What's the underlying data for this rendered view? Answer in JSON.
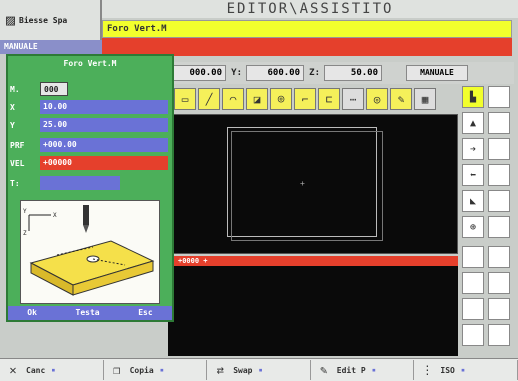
{
  "header": {
    "company": "Biesse Spa",
    "title": "EDITOR\\ASSISTITO",
    "file": "Foro Vert.M",
    "mode": "MANUALE"
  },
  "coords": [
    {
      "label": "",
      "value": "000.00"
    },
    {
      "label": "Y:",
      "value": "600.00"
    },
    {
      "label": "Z:",
      "value": "50.00"
    }
  ],
  "coord_mode": "MANUALE",
  "program_line": "+0000 +",
  "dialog": {
    "title": "Foro Vert.M",
    "fields": [
      {
        "label": "M.",
        "value": "000",
        "style": "sel"
      },
      {
        "label": "X",
        "value": "10.00",
        "style": "blue"
      },
      {
        "label": "Y",
        "value": "25.00",
        "style": "blue"
      },
      {
        "label": "PRF",
        "value": "+000.00",
        "style": "blue"
      },
      {
        "label": "VEL",
        "value": "+00000",
        "style": "red"
      },
      {
        "label": "T:",
        "value": "",
        "style": "bluesh"
      }
    ],
    "buttons": [
      "Ok",
      "Testa",
      "Esc"
    ]
  },
  "bottom_bar": [
    {
      "icon": "close-icon",
      "glyph": "✕",
      "label": "Canc"
    },
    {
      "icon": "copy-icon",
      "glyph": "❐",
      "label": "Copia"
    },
    {
      "icon": "swap-icon",
      "glyph": "⇄",
      "label": "Swap"
    },
    {
      "icon": "edit-icon",
      "glyph": "✎",
      "label": "Edit P"
    },
    {
      "icon": "iso-icon",
      "glyph": "⋮",
      "label": "ISO"
    }
  ],
  "colors": {
    "accent_yellow": "#f2ff2c",
    "accent_red": "#e5402c",
    "dialog_green": "#4caf5a",
    "field_blue": "#6a72d6"
  }
}
